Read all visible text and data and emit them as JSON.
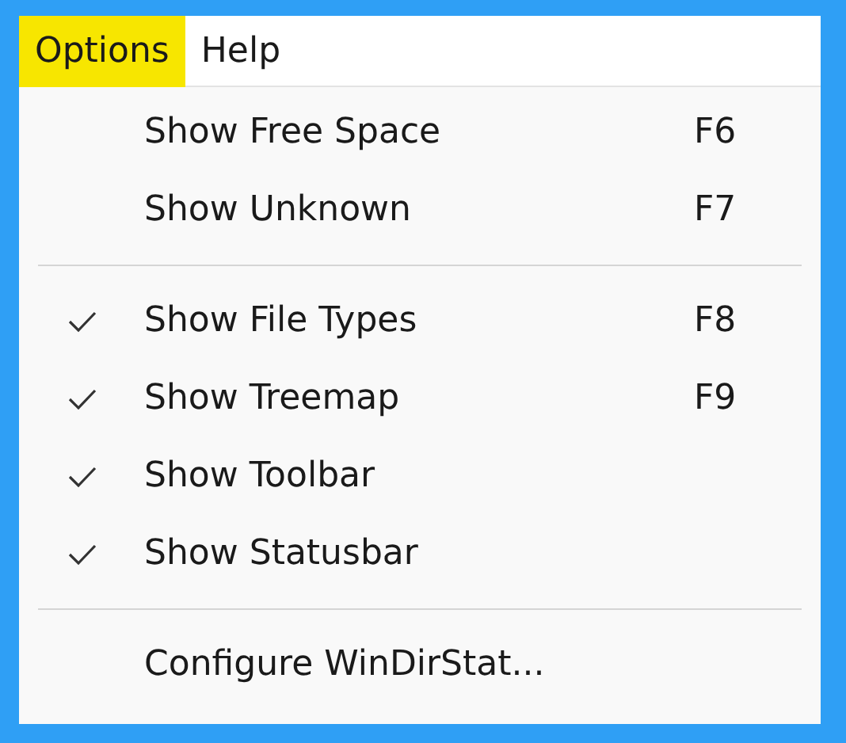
{
  "menubar": [
    {
      "label": "Options",
      "selected": true
    },
    {
      "label": "Help",
      "selected": false
    }
  ],
  "menu": {
    "items": [
      {
        "kind": "item",
        "label": "Show Free Space",
        "shortcut": "F6",
        "checked": false
      },
      {
        "kind": "item",
        "label": "Show Unknown",
        "shortcut": "F7",
        "checked": false
      },
      {
        "kind": "separator"
      },
      {
        "kind": "item",
        "label": "Show File Types",
        "shortcut": "F8",
        "checked": true
      },
      {
        "kind": "item",
        "label": "Show Treemap",
        "shortcut": "F9",
        "checked": true
      },
      {
        "kind": "item",
        "label": "Show Toolbar",
        "checked": true
      },
      {
        "kind": "item",
        "label": "Show Statusbar",
        "checked": true
      },
      {
        "kind": "separator"
      },
      {
        "kind": "item",
        "label": "Configure WinDirStat...",
        "checked": false
      }
    ]
  }
}
